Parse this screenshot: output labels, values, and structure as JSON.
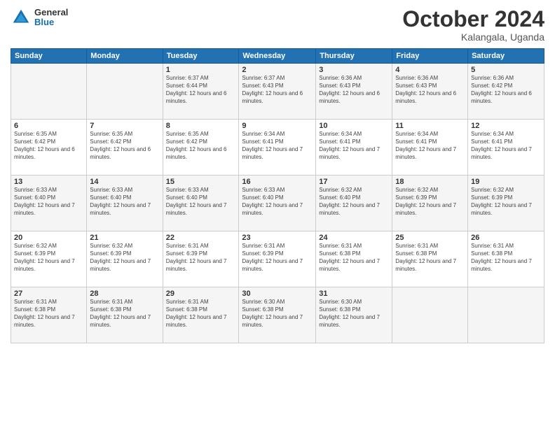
{
  "header": {
    "logo_general": "General",
    "logo_blue": "Blue",
    "month_title": "October 2024",
    "location": "Kalangala, Uganda"
  },
  "days_of_week": [
    "Sunday",
    "Monday",
    "Tuesday",
    "Wednesday",
    "Thursday",
    "Friday",
    "Saturday"
  ],
  "weeks": [
    [
      {
        "day": "",
        "info": ""
      },
      {
        "day": "",
        "info": ""
      },
      {
        "day": "1",
        "info": "Sunrise: 6:37 AM\nSunset: 6:44 PM\nDaylight: 12 hours and 6 minutes."
      },
      {
        "day": "2",
        "info": "Sunrise: 6:37 AM\nSunset: 6:43 PM\nDaylight: 12 hours and 6 minutes."
      },
      {
        "day": "3",
        "info": "Sunrise: 6:36 AM\nSunset: 6:43 PM\nDaylight: 12 hours and 6 minutes."
      },
      {
        "day": "4",
        "info": "Sunrise: 6:36 AM\nSunset: 6:43 PM\nDaylight: 12 hours and 6 minutes."
      },
      {
        "day": "5",
        "info": "Sunrise: 6:36 AM\nSunset: 6:42 PM\nDaylight: 12 hours and 6 minutes."
      }
    ],
    [
      {
        "day": "6",
        "info": "Sunrise: 6:35 AM\nSunset: 6:42 PM\nDaylight: 12 hours and 6 minutes."
      },
      {
        "day": "7",
        "info": "Sunrise: 6:35 AM\nSunset: 6:42 PM\nDaylight: 12 hours and 6 minutes."
      },
      {
        "day": "8",
        "info": "Sunrise: 6:35 AM\nSunset: 6:42 PM\nDaylight: 12 hours and 6 minutes."
      },
      {
        "day": "9",
        "info": "Sunrise: 6:34 AM\nSunset: 6:41 PM\nDaylight: 12 hours and 7 minutes."
      },
      {
        "day": "10",
        "info": "Sunrise: 6:34 AM\nSunset: 6:41 PM\nDaylight: 12 hours and 7 minutes."
      },
      {
        "day": "11",
        "info": "Sunrise: 6:34 AM\nSunset: 6:41 PM\nDaylight: 12 hours and 7 minutes."
      },
      {
        "day": "12",
        "info": "Sunrise: 6:34 AM\nSunset: 6:41 PM\nDaylight: 12 hours and 7 minutes."
      }
    ],
    [
      {
        "day": "13",
        "info": "Sunrise: 6:33 AM\nSunset: 6:40 PM\nDaylight: 12 hours and 7 minutes."
      },
      {
        "day": "14",
        "info": "Sunrise: 6:33 AM\nSunset: 6:40 PM\nDaylight: 12 hours and 7 minutes."
      },
      {
        "day": "15",
        "info": "Sunrise: 6:33 AM\nSunset: 6:40 PM\nDaylight: 12 hours and 7 minutes."
      },
      {
        "day": "16",
        "info": "Sunrise: 6:33 AM\nSunset: 6:40 PM\nDaylight: 12 hours and 7 minutes."
      },
      {
        "day": "17",
        "info": "Sunrise: 6:32 AM\nSunset: 6:40 PM\nDaylight: 12 hours and 7 minutes."
      },
      {
        "day": "18",
        "info": "Sunrise: 6:32 AM\nSunset: 6:39 PM\nDaylight: 12 hours and 7 minutes."
      },
      {
        "day": "19",
        "info": "Sunrise: 6:32 AM\nSunset: 6:39 PM\nDaylight: 12 hours and 7 minutes."
      }
    ],
    [
      {
        "day": "20",
        "info": "Sunrise: 6:32 AM\nSunset: 6:39 PM\nDaylight: 12 hours and 7 minutes."
      },
      {
        "day": "21",
        "info": "Sunrise: 6:32 AM\nSunset: 6:39 PM\nDaylight: 12 hours and 7 minutes."
      },
      {
        "day": "22",
        "info": "Sunrise: 6:31 AM\nSunset: 6:39 PM\nDaylight: 12 hours and 7 minutes."
      },
      {
        "day": "23",
        "info": "Sunrise: 6:31 AM\nSunset: 6:39 PM\nDaylight: 12 hours and 7 minutes."
      },
      {
        "day": "24",
        "info": "Sunrise: 6:31 AM\nSunset: 6:38 PM\nDaylight: 12 hours and 7 minutes."
      },
      {
        "day": "25",
        "info": "Sunrise: 6:31 AM\nSunset: 6:38 PM\nDaylight: 12 hours and 7 minutes."
      },
      {
        "day": "26",
        "info": "Sunrise: 6:31 AM\nSunset: 6:38 PM\nDaylight: 12 hours and 7 minutes."
      }
    ],
    [
      {
        "day": "27",
        "info": "Sunrise: 6:31 AM\nSunset: 6:38 PM\nDaylight: 12 hours and 7 minutes."
      },
      {
        "day": "28",
        "info": "Sunrise: 6:31 AM\nSunset: 6:38 PM\nDaylight: 12 hours and 7 minutes."
      },
      {
        "day": "29",
        "info": "Sunrise: 6:31 AM\nSunset: 6:38 PM\nDaylight: 12 hours and 7 minutes."
      },
      {
        "day": "30",
        "info": "Sunrise: 6:30 AM\nSunset: 6:38 PM\nDaylight: 12 hours and 7 minutes."
      },
      {
        "day": "31",
        "info": "Sunrise: 6:30 AM\nSunset: 6:38 PM\nDaylight: 12 hours and 7 minutes."
      },
      {
        "day": "",
        "info": ""
      },
      {
        "day": "",
        "info": ""
      }
    ]
  ]
}
